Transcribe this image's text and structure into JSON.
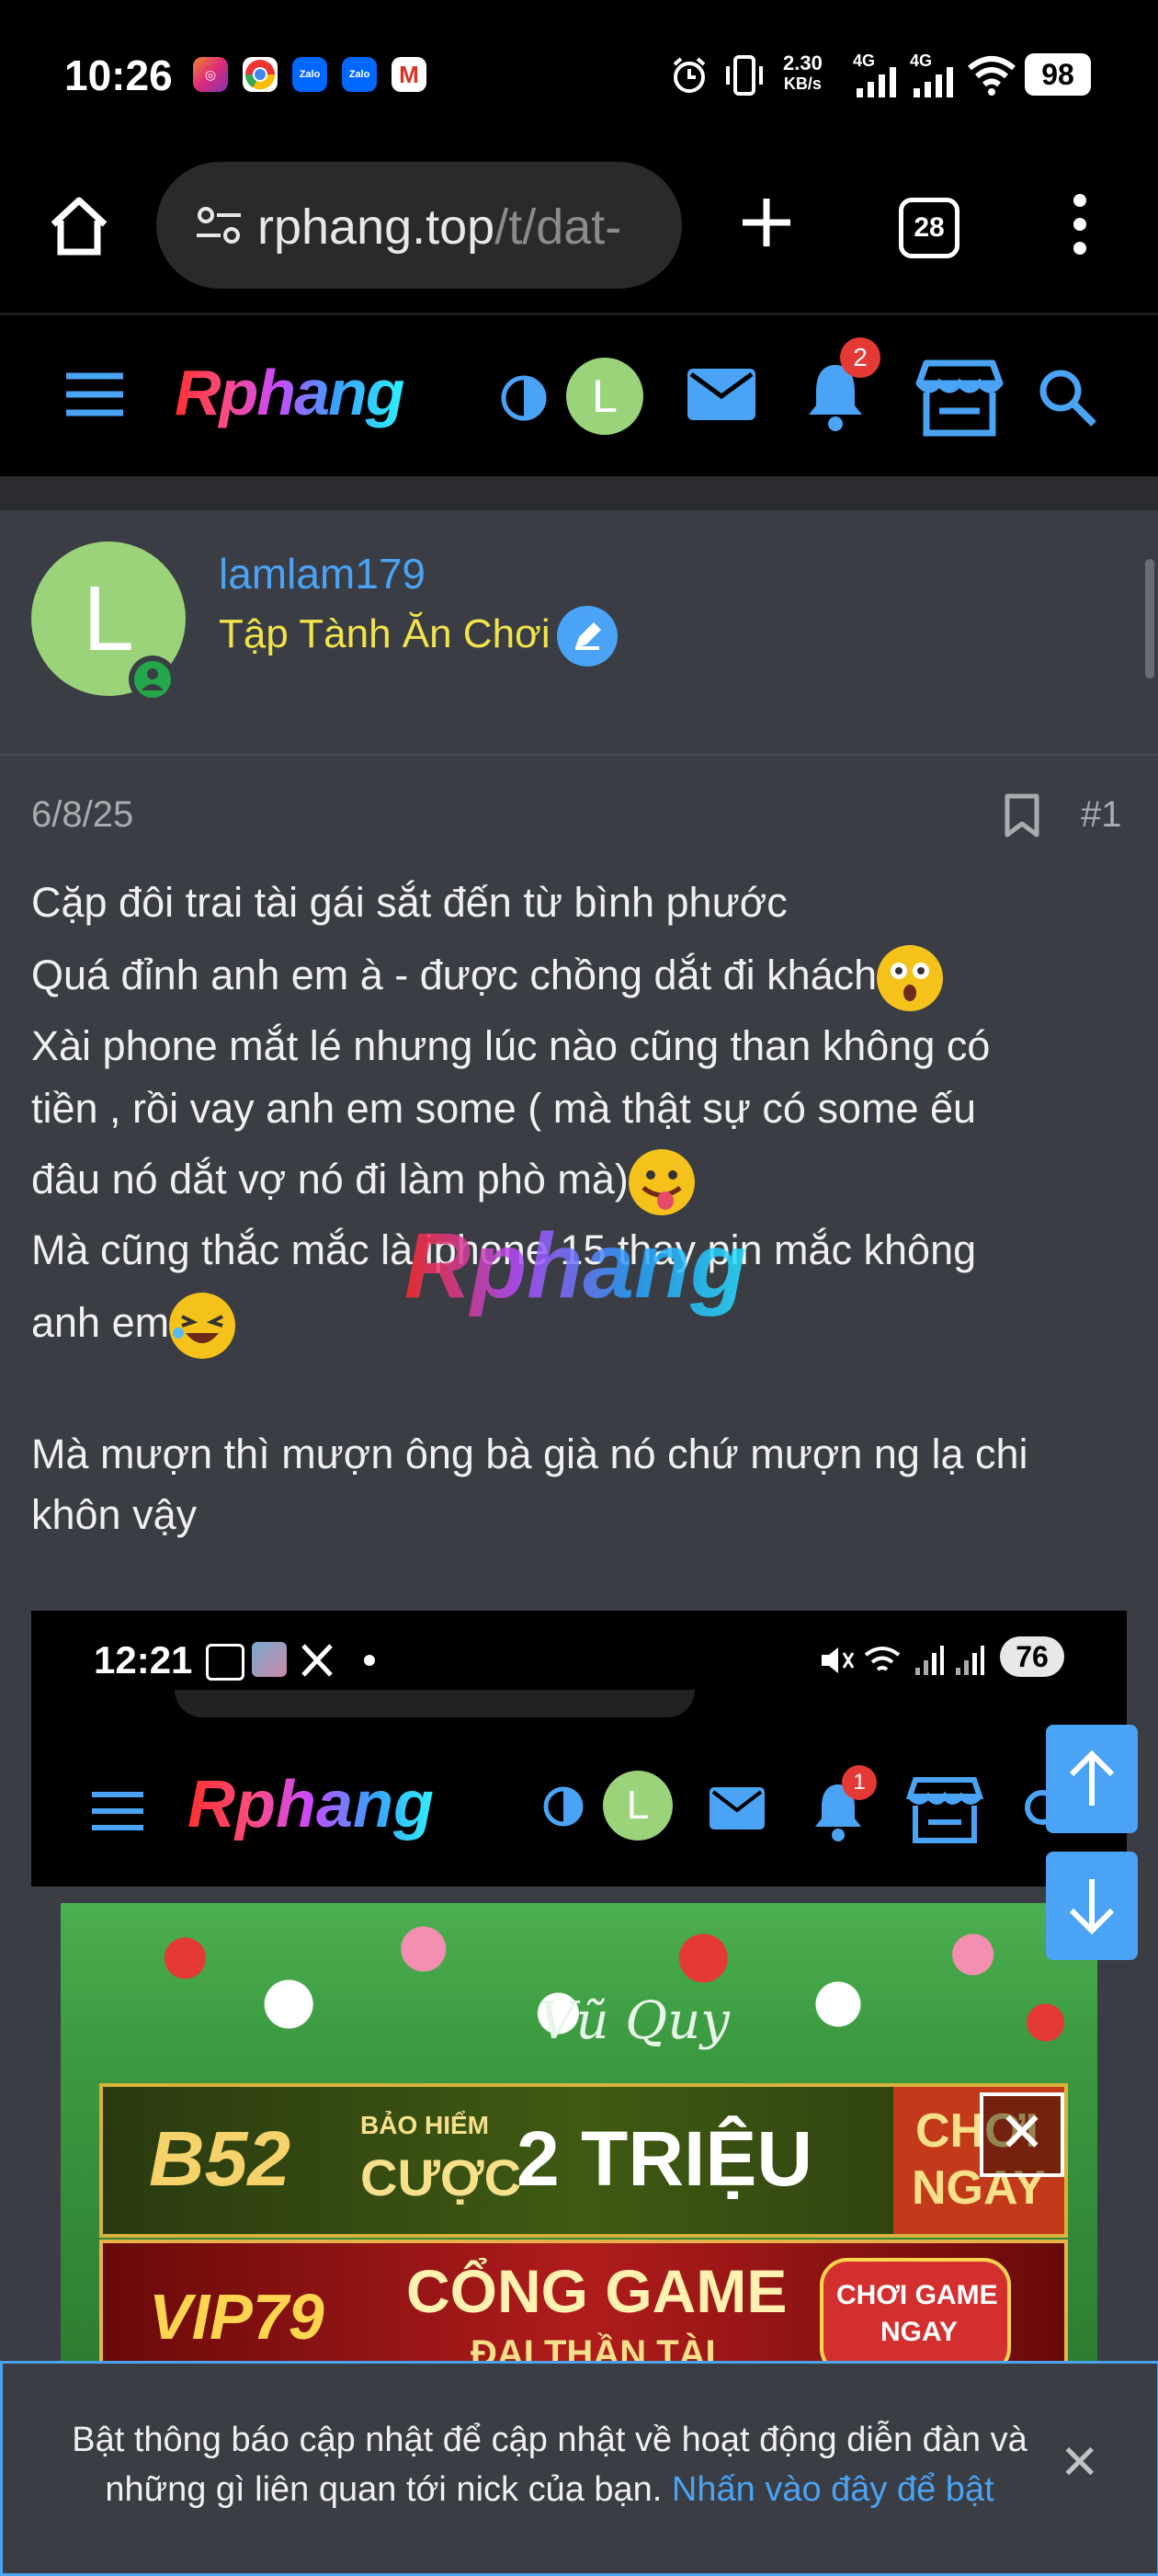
{
  "status_bar": {
    "time": "10:26",
    "network_speed_value": "2.30",
    "network_speed_unit": "KB/s",
    "network_type_1": "4G",
    "network_type_2": "4G",
    "battery": "98",
    "app_icons": [
      "instagram-icon",
      "chrome-icon",
      "zalo-icon",
      "zalo-icon",
      "gmail-icon"
    ],
    "zalo_label": "Zalo"
  },
  "browser": {
    "url_host": "rphang.top",
    "url_path": "/t/dat-",
    "tab_count": "28"
  },
  "site_header": {
    "logo": "Rphang",
    "avatar_letter": "L",
    "notification_count": "2"
  },
  "post": {
    "author": "lamlam179",
    "user_title": "Tập Tành Ăn Chơi",
    "avatar_letter": "L",
    "date": "6/8/25",
    "post_number": "#1",
    "lines": [
      "Cặp đôi trai tài gái sắt đến từ bình phước",
      "Quá đỉnh anh em à - được chồng dắt đi khách",
      "Xài phone mắt lé nhưng lúc nào cũng than không có",
      "tiền , rồi vay anh em some ( mà thật sự có some ếu",
      "đâu nó dắt vợ nó đi làm phò mà)",
      "Mà cũng thắc mắc là iphone 15 thay pin mắc không",
      "anh em",
      "Mà mượn thì mượn ông bà già nó chứ mượn ng lạ chi",
      "khôn vậy"
    ],
    "watermark": "Rphang"
  },
  "embedded_screenshot": {
    "time": "12:21",
    "battery": "76",
    "logo": "Rphang",
    "avatar_letter": "L",
    "notification_count": "1"
  },
  "photo": {
    "sign_text": "Vũ Quy",
    "ad1": {
      "brand": "B52",
      "line1": "BẢO HIỂM",
      "line2": "CƯỢC",
      "big": "2 TRIỆU",
      "cta1": "CHƠI",
      "cta2": "NGAY"
    },
    "ad2": {
      "brand": "VIP79",
      "big": "CỔNG GAME",
      "sub": "ĐẠI THẦN TÀI",
      "cta1": "CHƠI GAME",
      "cta2": "NGAY"
    },
    "close_glyph": "✕"
  },
  "notification": {
    "text": "Bật thông báo cập nhật để cập nhật về hoạt động diễn đàn và những gì liên quan tới nick của bạn.",
    "link": "Nhấn vào đây để bật",
    "close_glyph": "✕"
  },
  "colors": {
    "accent": "#4aa3f5",
    "user_title": "#f2e34a",
    "avatar": "#9bd37a",
    "badge": "#e53935",
    "background": "#2a2c30",
    "card": "#3a3d43"
  }
}
